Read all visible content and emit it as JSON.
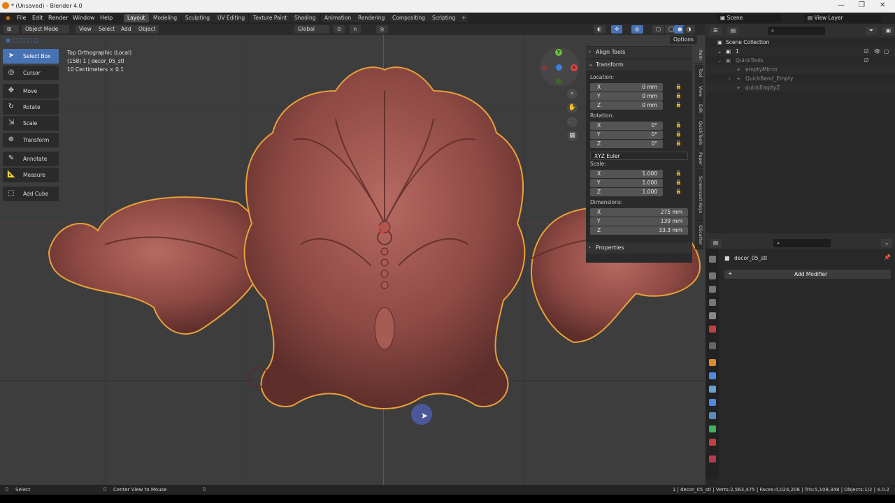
{
  "window": {
    "title": "* (Unsaved) - Blender 4.0"
  },
  "menu": [
    "File",
    "Edit",
    "Render",
    "Window",
    "Help"
  ],
  "workspaces": [
    "Layout",
    "Modeling",
    "Sculpting",
    "UV Editing",
    "Texture Paint",
    "Shading",
    "Animation",
    "Rendering",
    "Compositing",
    "Scripting"
  ],
  "scene": {
    "label": "Scene",
    "view_layer": "View Layer"
  },
  "viewport_header": {
    "mode": "Object Mode",
    "menus": [
      "View",
      "Select",
      "Add",
      "Object"
    ],
    "transform_orientation": "Global",
    "options_label": "Options"
  },
  "viewport_info": {
    "line1": "Top Orthographic (Local)",
    "line2": "(158) 1 | decor_05_stl",
    "line3": "10 Centimeters × 0.1"
  },
  "tools": [
    {
      "label": "Select Box",
      "icon": "select-box-icon",
      "active": true
    },
    {
      "label": "Cursor",
      "icon": "cursor-icon"
    },
    {
      "label": "Move",
      "icon": "move-icon"
    },
    {
      "label": "Rotate",
      "icon": "rotate-icon"
    },
    {
      "label": "Scale",
      "icon": "scale-icon"
    },
    {
      "label": "Transform",
      "icon": "transform-icon"
    },
    {
      "label": "Annotate",
      "icon": "annotate-icon"
    },
    {
      "label": "Measure",
      "icon": "measure-icon"
    },
    {
      "label": "Add Cube",
      "icon": "add-cube-icon"
    }
  ],
  "npanel": {
    "align_tools": "Align Tools",
    "transform": "Transform",
    "location_label": "Location:",
    "location": {
      "x": "0 mm",
      "y": "0 mm",
      "z": "0 mm"
    },
    "rotation_label": "Rotation:",
    "rotation": {
      "x": "0°",
      "y": "0°",
      "z": "0°"
    },
    "rotation_mode": "XYZ Euler",
    "scale_label": "Scale:",
    "scale": {
      "x": "1.000",
      "y": "1.000",
      "z": "1.000"
    },
    "dimensions_label": "Dimensions:",
    "dimensions": {
      "x": "275 mm",
      "y": "139 mm",
      "z": "33.3 mm"
    },
    "properties": "Properties",
    "axis": {
      "x": "X",
      "y": "Y",
      "z": "Z"
    }
  },
  "vertical_tabs": [
    "Item",
    "Tool",
    "View",
    "Edit",
    "QuickTools",
    "Paper",
    "Screencast Keys",
    "GScatter"
  ],
  "outliner": {
    "root": "Scene Collection",
    "items": [
      {
        "label": "1",
        "depth": 1
      },
      {
        "label": "QuickTools",
        "depth": 1
      },
      {
        "label": "emptyMirror",
        "depth": 2
      },
      {
        "label": "QuickBend_Empty",
        "depth": 2
      },
      {
        "label": "quickEmptyZ",
        "depth": 2
      }
    ]
  },
  "properties": {
    "object_name": "decor_05_stl",
    "add_modifier": "Add Modifier"
  },
  "statusbar": {
    "left": "Select",
    "center": "Center View to Mouse",
    "right": "1 | decor_05_stl | Verts:2,563,475 | Faces:4,024,206 | Tris:5,108,348 | Objects:1/2 | 4.0.2"
  },
  "colors": {
    "accent": "#4772b3",
    "model": "#8f4a44",
    "outline": "#e8a03a"
  }
}
